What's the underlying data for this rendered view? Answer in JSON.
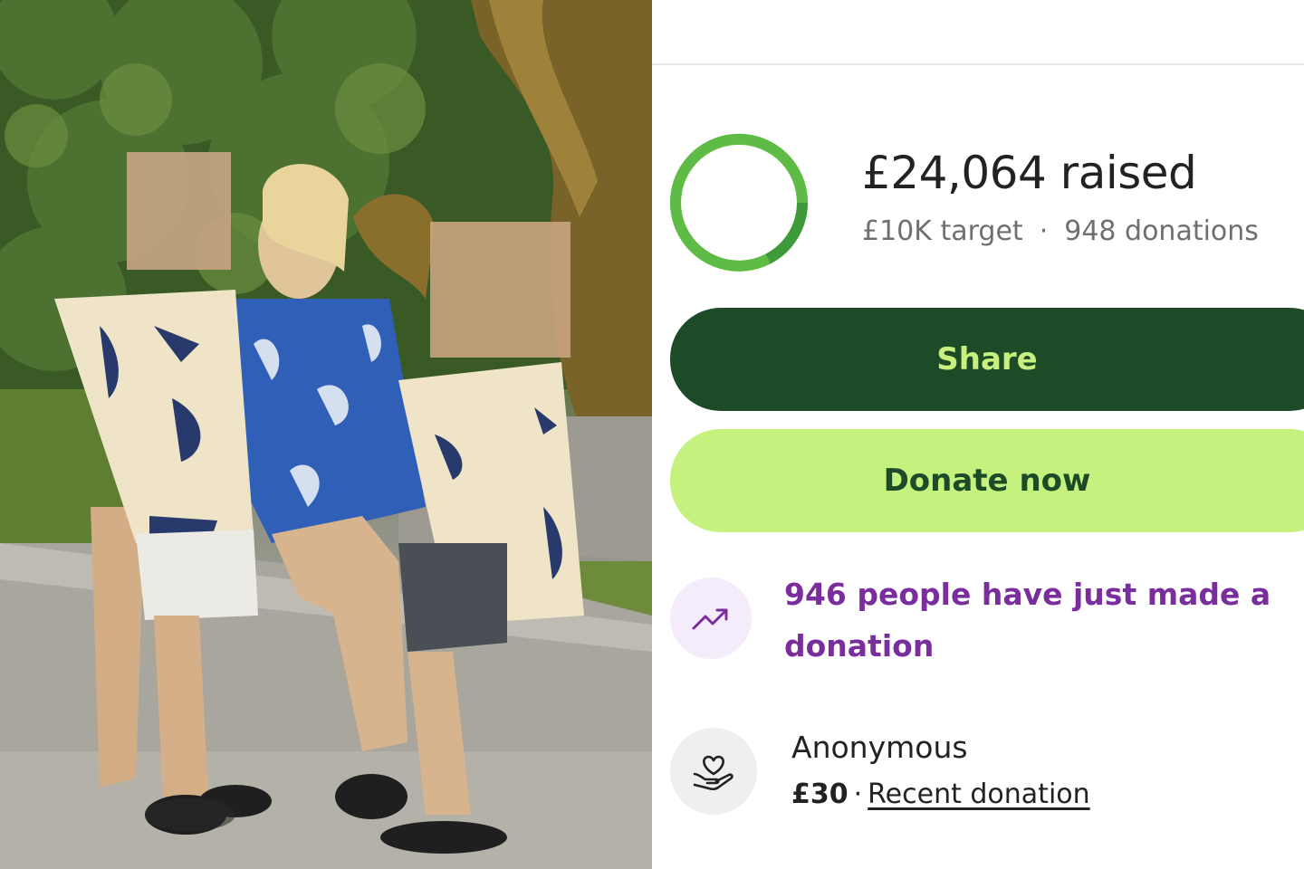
{
  "fundraiser": {
    "raised_amount": "£24,064 raised",
    "target": "£10K target",
    "separator": "·",
    "donation_count": "948 donations",
    "progress_fraction": 1.0
  },
  "actions": {
    "share_label": "Share",
    "donate_label": "Donate now"
  },
  "activity": {
    "trend_message": "946 people have just made a donation",
    "trend_icon": "trending-up-icon"
  },
  "recent_donation": {
    "donor_name": "Anonymous",
    "amount": "£30",
    "separator": "·",
    "link_label": "Recent donation",
    "donor_icon": "hand-heart-icon"
  },
  "colors": {
    "dark_green": "#1d4a27",
    "lime": "#c5f17f",
    "ring_green": "#5dbb46",
    "purple": "#7a2e9e"
  }
}
